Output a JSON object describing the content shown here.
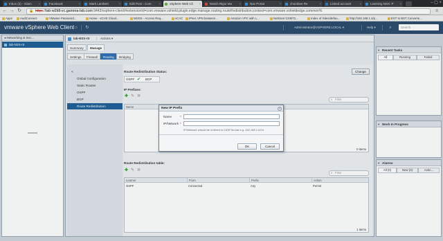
{
  "browser": {
    "tabs": [
      {
        "label": "Inbox (2) - mlam",
        "active": false
      },
      {
        "label": "Facebook",
        "active": false
      },
      {
        "label": "Mark Lambert",
        "active": false
      },
      {
        "label": "Edit Post ‹ Com",
        "active": false
      },
      {
        "label": "vSphere Web Cli",
        "active": true
      },
      {
        "label": "Watch Rigor Mo",
        "active": false
      },
      {
        "label": "Nav Portal",
        "active": false
      },
      {
        "label": "chumbee Re",
        "active": false
      },
      {
        "label": "Linked account",
        "active": false
      },
      {
        "label": "Learning NSX: P",
        "active": false
      }
    ],
    "url_scheme": "https",
    "url_host": "lab-w2k8-vc.gamma-lab.com",
    "url_rest": ":9443/vsphere-client/#extensionId=com.vmware.vshield.plugin.edge.manage.routing.routeRedistribution;context=com.vmware.vshieldedge.common%",
    "bookmarks": [
      "Apps",
      "AudiConnect",
      "VMware Password...",
      "Home - vCHS Cloud...",
      "MOSS - Access Req...",
      "vCAC",
      "IPsec VPN between...",
      "Amazon VPC with L...",
      "NetGear GSM72...",
      "Index of /sites/defau...",
      "http://192.168.1.4/p...",
      "EST to BST Converte..."
    ]
  },
  "header": {
    "brand": "vm",
    "brand_suffix": "ware",
    "product": " vSphere Web Client",
    "user": "Administrator@VSPHERE.LOCAL",
    "help": "Help",
    "search_placeholder": "Search"
  },
  "left_panel": {
    "nav_title": "◂ Networking & Sec...",
    "selected_item": "lab-NSX-rtr"
  },
  "center": {
    "object_name": "lab-NSX-rtr",
    "actions": "Actions ▾",
    "main_tabs": [
      "Summary",
      "Manage"
    ],
    "sub_tabs": [
      "Settings",
      "Firewall",
      "Routing",
      "Bridging"
    ],
    "side_menu": [
      "Global Configuration",
      "Static Routes",
      "OSPF",
      "BGP",
      "Route Redistribution"
    ],
    "selected_side": "Route Redistribution",
    "status_title": "Route Redistribution Status:",
    "change_button": "Change",
    "status_protocols": [
      "OSPF",
      "BGP"
    ],
    "prefixes_title": "IP Prefixes:",
    "prefix_columns": [
      "Name",
      "IP/Network"
    ],
    "prefix_count": "0 items",
    "table_title": "Route Redistribution table:",
    "table_columns": [
      "Learner",
      "From",
      "Prefix",
      "Action"
    ],
    "table_rows": [
      {
        "learner": "OSPF",
        "from": "Connected",
        "prefix": "Any",
        "action": "Permit"
      }
    ],
    "table_count": "1 items",
    "filter_placeholder": "Filter"
  },
  "right_panel": {
    "recent_tasks": {
      "title": "Recent Tasks",
      "tabs": [
        "All",
        "Running",
        "Failed"
      ],
      "my_tasks": "My Tasks ▾",
      "more_tasks": "More Tasks"
    },
    "work_in_progress": {
      "title": "Work In Progress"
    },
    "alarms": {
      "title": "Alarms",
      "tabs": [
        "All (0)",
        "New (0)",
        "Ackn..."
      ]
    }
  },
  "dialog": {
    "title": "New IP Prefix",
    "name_label": "Name",
    "network_label": "IP/Network",
    "required_mark": "*",
    "name_value": "",
    "network_value": "",
    "hint": "IP/Network should be entered in CIDR format e.g. 192.168.1.0/24",
    "ok": "OK",
    "cancel": "Cancel"
  }
}
